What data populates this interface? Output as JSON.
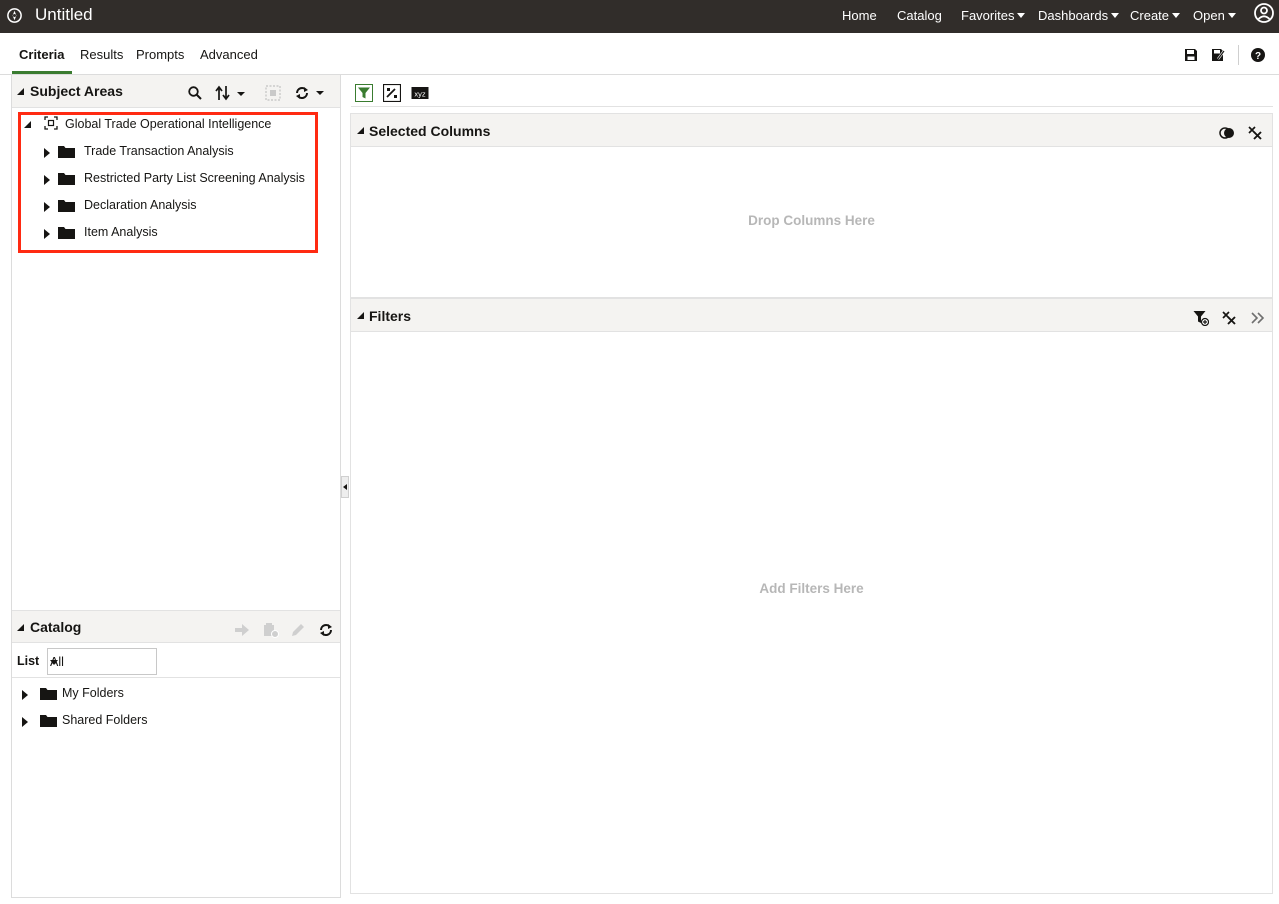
{
  "header": {
    "title": "Untitled",
    "nav": [
      {
        "label": "Home",
        "has_menu": false
      },
      {
        "label": "Catalog",
        "has_menu": false
      },
      {
        "label": "Favorites",
        "has_menu": true
      },
      {
        "label": "Dashboards",
        "has_menu": true
      },
      {
        "label": "Create",
        "has_menu": true
      },
      {
        "label": "Open",
        "has_menu": true
      }
    ],
    "user_icon": "user-circle-icon"
  },
  "tabs": [
    {
      "label": "Criteria",
      "active": true
    },
    {
      "label": "Results",
      "active": false
    },
    {
      "label": "Prompts",
      "active": false
    },
    {
      "label": "Advanced",
      "active": false
    }
  ],
  "top_right_icons": [
    "save-icon",
    "save-as-icon",
    "help-icon"
  ],
  "subject_areas": {
    "title": "Subject Areas",
    "toolbar_icons": [
      "search-icon",
      "sort-icon",
      "add-subject-area-icon",
      "refresh-icon"
    ],
    "root": {
      "label": "Global Trade Operational Intelligence",
      "children": [
        "Trade Transaction Analysis",
        "Restricted Party List Screening Analysis",
        "Declaration Analysis",
        "Item Analysis"
      ]
    }
  },
  "catalog": {
    "title": "Catalog",
    "toolbar_icons": [
      "open-arrow-icon",
      "properties-icon",
      "edit-icon",
      "refresh-icon"
    ],
    "list_label": "List",
    "list_value": "All",
    "items": [
      "My Folders",
      "Shared Folders"
    ]
  },
  "criteria_toolbar_icons": [
    "filter-icon",
    "column-formula-icon",
    "xyz-icon"
  ],
  "selected_columns": {
    "title": "Selected Columns",
    "placeholder": "Drop Columns Here",
    "icons": [
      "toggle-icon",
      "remove-all-icon"
    ]
  },
  "filters": {
    "title": "Filters",
    "placeholder": "Add Filters Here",
    "icons": [
      "add-filter-icon",
      "remove-all-icon",
      "expand-right-icon"
    ]
  },
  "colors": {
    "topbar_bg": "#312d2a",
    "accent_green": "#3a7c30",
    "highlight_red": "#ff2a12",
    "panel_header_bg": "#f4f3f1",
    "placeholder_text": "#b7b7b7"
  }
}
